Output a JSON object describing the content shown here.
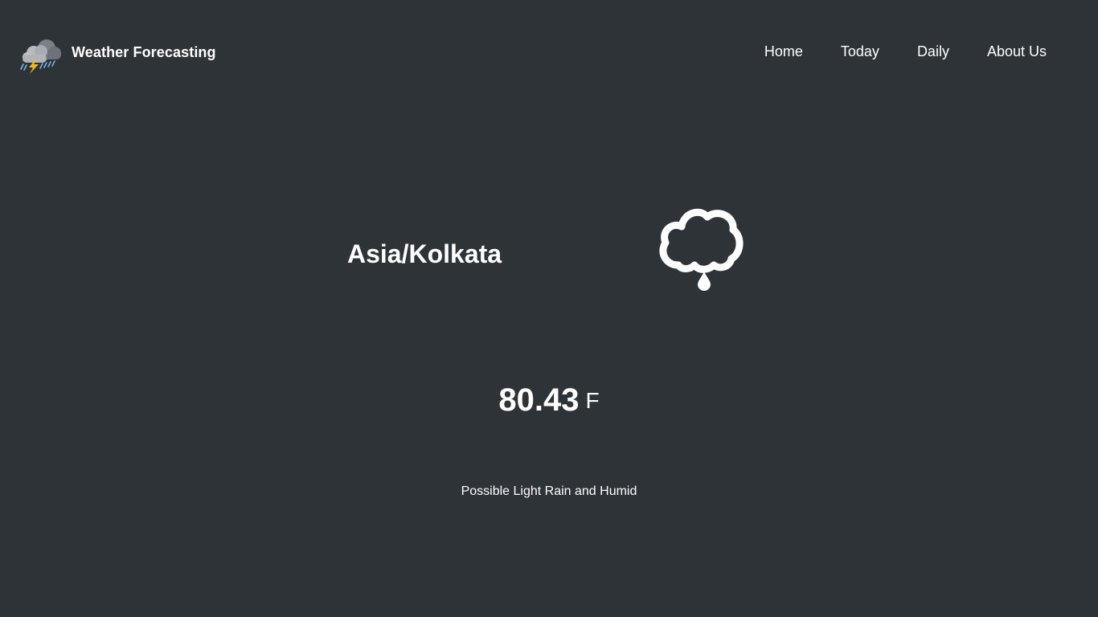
{
  "header": {
    "brand_title": "Weather Forecasting",
    "logo_icon": "thunderstorm-rain-cloud-icon",
    "nav": [
      {
        "label": "Home"
      },
      {
        "label": "Today"
      },
      {
        "label": "Daily"
      },
      {
        "label": "About Us"
      }
    ]
  },
  "main": {
    "timezone": "Asia/Kolkata",
    "condition_icon": "cloud-drizzle-icon",
    "temperature": "80.43",
    "unit": "F",
    "summary": "Possible Light Rain and Humid"
  },
  "colors": {
    "background": "#2d3336",
    "text": "#ffffff"
  }
}
